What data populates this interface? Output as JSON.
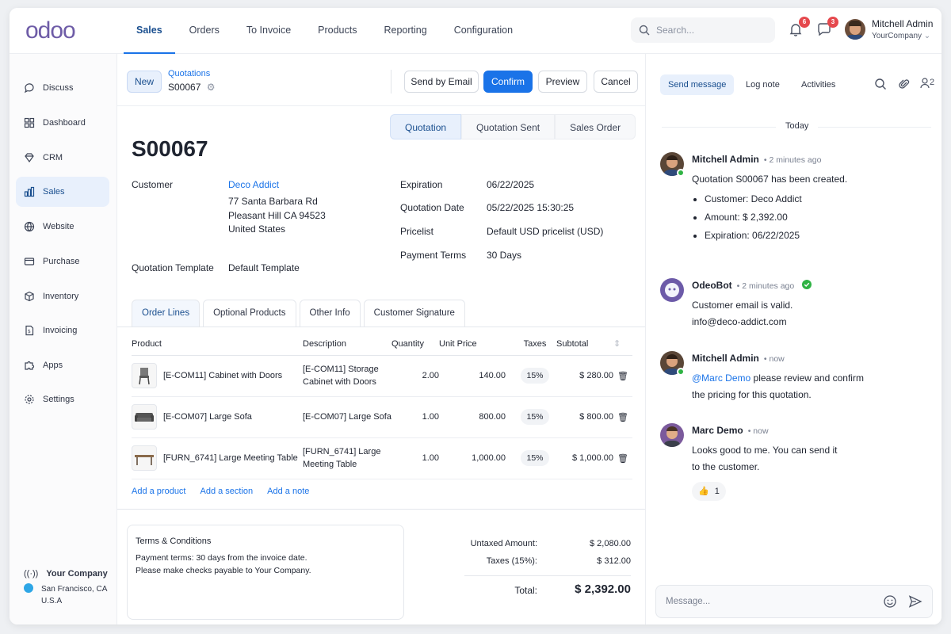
{
  "app": {
    "logo": "odoo",
    "nav": [
      "Sales",
      "Orders",
      "To Invoice",
      "Products",
      "Reporting",
      "Configuration"
    ],
    "search_placeholder": "Search...",
    "notifications_count": "6",
    "messages_count": "3",
    "user_name": "Mitchell Admin",
    "user_company": "YourCompany"
  },
  "sidebar": {
    "items": [
      "Discuss",
      "Dashboard",
      "CRM",
      "Sales",
      "Website",
      "Purchase",
      "Inventory",
      "Invoicing",
      "Apps",
      "Settings"
    ],
    "company_name": "Your Company",
    "company_city": "San Francisco, CA",
    "company_country": "U.S.A"
  },
  "control": {
    "new_label": "New",
    "breadcrumb": "Quotations",
    "record": "S00067",
    "send_email": "Send by Email",
    "confirm": "Confirm",
    "preview": "Preview",
    "cancel": "Cancel"
  },
  "status": [
    "Quotation",
    "Quotation Sent",
    "Sales Order"
  ],
  "form": {
    "title": "S00067",
    "customer_label": "Customer",
    "customer_name": "Deco Addict",
    "addr1": "77 Santa Barbara Rd",
    "addr2": "Pleasant Hill CA 94523",
    "addr3": "United States",
    "template_label": "Quotation Template",
    "template_value": "Default Template",
    "expiration_label": "Expiration",
    "expiration_value": "06/22/2025",
    "qdate_label": "Quotation Date",
    "qdate_value": "05/22/2025 15:30:25",
    "pricelist_label": "Pricelist",
    "pricelist_value": "Default USD pricelist (USD)",
    "terms_label": "Payment Terms",
    "terms_value": "30 Days"
  },
  "tabs": [
    "Order Lines",
    "Optional Products",
    "Other Info",
    "Customer Signature"
  ],
  "lines": {
    "headers": [
      "Product",
      "Description",
      "Quantity",
      "Unit Price",
      "Taxes",
      "Subtotal"
    ],
    "rows": [
      {
        "product": "[E-COM11] Cabinet with Doors",
        "desc1": "[E-COM11] Storage",
        "desc2": "Cabinet with Doors",
        "qty": "2.00",
        "price": "140.00",
        "tax": "15%",
        "subtotal": "$ 280.00"
      },
      {
        "product": "[E-COM07] Large Sofa",
        "desc1": "[E-COM07] Large Sofa",
        "desc2": "",
        "qty": "1.00",
        "price": "800.00",
        "tax": "15%",
        "subtotal": "$ 800.00"
      },
      {
        "product": "[FURN_6741] Large Meeting Table",
        "desc1": "[FURN_6741] Large",
        "desc2": "Meeting Table",
        "qty": "1.00",
        "price": "1,000.00",
        "tax": "15%",
        "subtotal": "$ 1,000.00"
      }
    ],
    "add_product": "Add a product",
    "add_section": "Add a section",
    "add_note": "Add a note"
  },
  "terms": {
    "title": "Terms & Conditions",
    "line1": "Payment terms: 30 days from the invoice date.",
    "line2": "Please make checks payable to Your Company."
  },
  "totals": {
    "untaxed_label": "Untaxed Amount:",
    "untaxed_value": "$ 2,080.00",
    "taxes_label": "Taxes (15%):",
    "taxes_value": "$ 312.00",
    "total_label": "Total:",
    "total_value": "$ 2,392.00"
  },
  "chatter": {
    "send_message": "Send message",
    "log_note": "Log note",
    "activities": "Activities",
    "followers_count": "2",
    "today": "Today",
    "messages": [
      {
        "author": "Mitchell Admin",
        "time": "2 minutes ago",
        "text": "Quotation S00067 has been created.",
        "bullets": [
          "Customer: Deco Addict",
          "Amount: $ 2,392.00",
          "Expiration: 06/22/2025"
        ]
      },
      {
        "author": "OdeoBot",
        "time": "2 minutes ago",
        "line1": "Customer email is valid.",
        "line2": "info@deco-addict.com"
      },
      {
        "author": "Mitchell Admin",
        "time": "now",
        "mention": "@Marc Demo",
        "line1": " please review and confirm",
        "line2": "the pricing for this quotation."
      },
      {
        "author": "Marc Demo",
        "time": "now",
        "line1": "Looks good to me. You can send it",
        "line2": "to the customer."
      }
    ],
    "reaction_count": "1",
    "composer_placeholder": "Message..."
  }
}
